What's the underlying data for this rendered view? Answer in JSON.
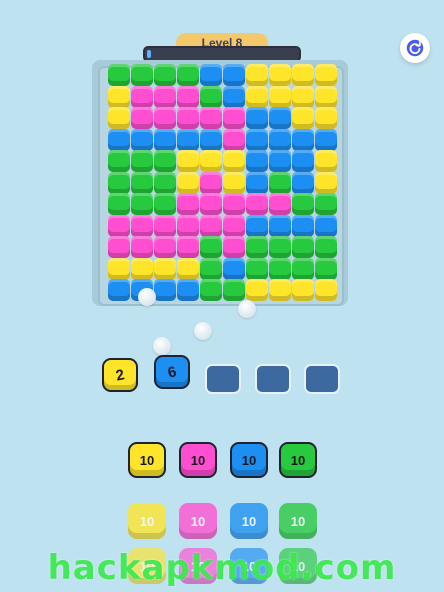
{
  "hud": {
    "level_label": "Level 8",
    "progress": 0.02,
    "restart_icon": "restart-icon"
  },
  "palette": {
    "G": "#27c93f",
    "Y": "#ffe52a",
    "P": "#ff4fd0",
    "B": "#1e8ff2",
    "O": "#ffd000"
  },
  "board": {
    "rows": [
      "GGGGBBYYYY",
      "YPPPGBYYYY",
      "YPPPPPBBYY",
      "BBBBBPBBBB",
      "GGGYYYBBBY",
      "GGGYPYBGBY",
      "GGGPPPPPGG",
      "PPPPPPBBBB",
      "PPPPGPGGGG",
      "YYYYGBGGGG",
      "BBBBGGYYYY"
    ]
  },
  "tray": {
    "shooters": [
      {
        "value": "2",
        "color": "Y"
      },
      {
        "value": "6",
        "color": "B"
      }
    ],
    "empty_slots": 3
  },
  "queue": {
    "rows": [
      [
        {
          "value": "10",
          "color": "Y"
        },
        {
          "value": "10",
          "color": "P"
        },
        {
          "value": "10",
          "color": "B"
        },
        {
          "value": "10",
          "color": "G"
        }
      ],
      [
        {
          "value": "10",
          "color": "Y"
        },
        {
          "value": "10",
          "color": "P"
        },
        {
          "value": "10",
          "color": "B"
        },
        {
          "value": "10",
          "color": "G"
        }
      ],
      [
        {
          "value": "10",
          "color": "Y"
        },
        {
          "value": "10",
          "color": "P"
        },
        {
          "value": "10",
          "color": "B"
        },
        {
          "value": "10",
          "color": "G"
        }
      ]
    ]
  },
  "watermark": "hackapkmod.com"
}
